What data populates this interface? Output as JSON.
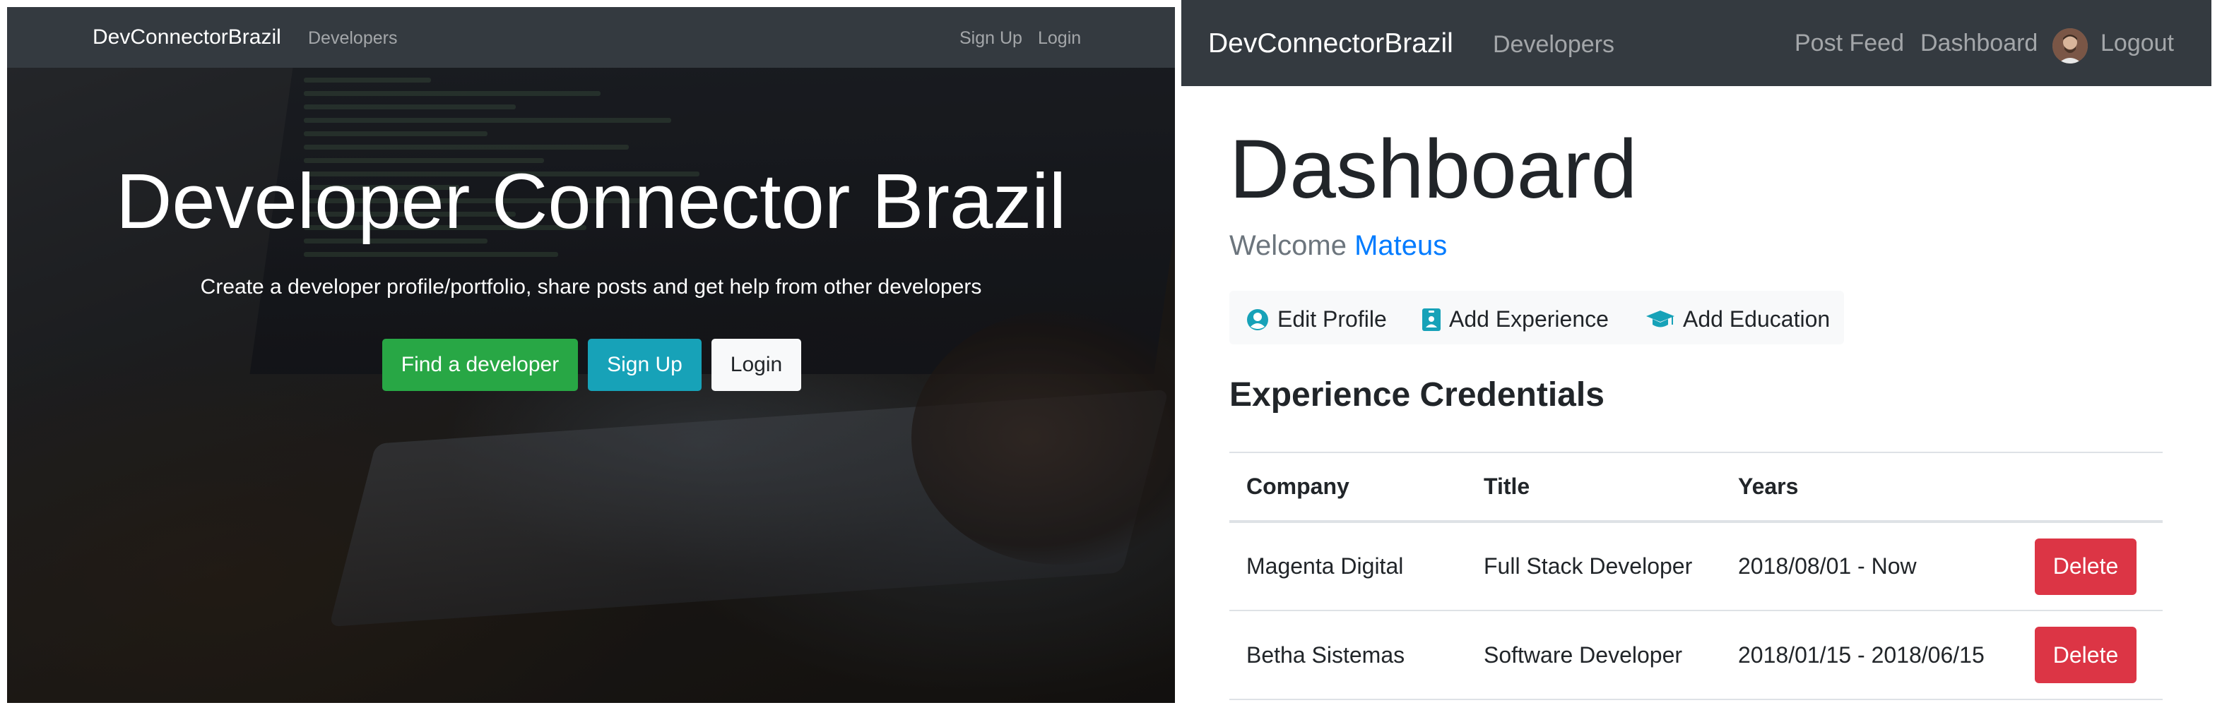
{
  "left": {
    "navbar": {
      "brand": "DevConnectorBrazil",
      "developers": "Developers",
      "signup": "Sign Up",
      "login": "Login"
    },
    "hero": {
      "title": "Developer Connector Brazil",
      "lead": "Create a developer profile/portfolio, share posts and get help from other developers",
      "buttons": {
        "find": "Find a developer",
        "signup": "Sign Up",
        "login": "Login"
      }
    }
  },
  "right": {
    "navbar": {
      "brand": "DevConnectorBrazil",
      "developers": "Developers",
      "post_feed": "Post Feed",
      "dashboard": "Dashboard",
      "logout": "Logout"
    },
    "dashboard": {
      "title": "Dashboard",
      "welcome_prefix": "Welcome",
      "user_name": "Mateus",
      "actions": {
        "edit_profile": "Edit Profile",
        "add_experience": "Add Experience",
        "add_education": "Add Education"
      },
      "experience": {
        "heading": "Experience Credentials",
        "headers": [
          "Company",
          "Title",
          "Years"
        ],
        "rows": [
          {
            "company": "Magenta Digital",
            "title": "Full Stack Developer",
            "years": "2018/08/01 - Now",
            "action": "Delete"
          },
          {
            "company": "Betha Sistemas",
            "title": "Software Developer",
            "years": "2018/01/15 - 2018/06/15",
            "action": "Delete"
          }
        ]
      }
    }
  },
  "colors": {
    "navbar": "#343a40",
    "success": "#28a745",
    "info": "#17a2b8",
    "danger": "#dc3545",
    "link": "#007bff"
  },
  "icons": {
    "edit_profile": "user-circle-icon",
    "add_experience": "id-badge-icon",
    "add_education": "graduation-cap-icon"
  }
}
